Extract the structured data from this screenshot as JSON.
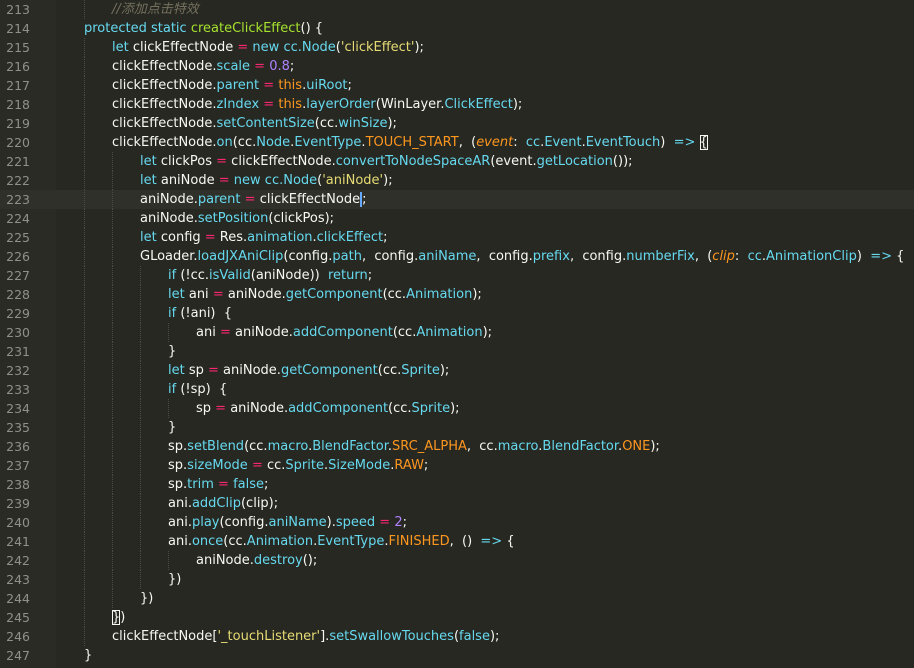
{
  "editor": {
    "lines": [
      {
        "n": "213",
        "indent": 1,
        "tokens": [
          [
            "cm",
            "//添加点击特效"
          ]
        ]
      },
      {
        "n": "214",
        "indent": 0,
        "tokens": [
          [
            "kw",
            "protected"
          ],
          [
            "t",
            " "
          ],
          [
            "kw",
            "static"
          ],
          [
            "t",
            " "
          ],
          [
            "fn",
            "createClickEffect"
          ],
          [
            "t",
            "() {"
          ]
        ]
      },
      {
        "n": "215",
        "indent": 1,
        "tokens": [
          [
            "kw",
            "let"
          ],
          [
            "t",
            " clickEffectNode "
          ],
          [
            "op",
            "="
          ],
          [
            "t",
            " "
          ],
          [
            "kw",
            "new"
          ],
          [
            "t",
            " "
          ],
          [
            "cl",
            "cc.Node"
          ],
          [
            "t",
            "("
          ],
          [
            "st",
            "'clickEffect'"
          ],
          [
            "t",
            ");"
          ]
        ]
      },
      {
        "n": "216",
        "indent": 1,
        "tokens": [
          [
            "t",
            "clickEffectNode."
          ],
          [
            "pr",
            "scale"
          ],
          [
            "t",
            " "
          ],
          [
            "op",
            "="
          ],
          [
            "t",
            " "
          ],
          [
            "nu",
            "0.8"
          ],
          [
            "t",
            ";"
          ]
        ]
      },
      {
        "n": "217",
        "indent": 1,
        "tokens": [
          [
            "t",
            "clickEffectNode."
          ],
          [
            "pr",
            "parent"
          ],
          [
            "t",
            " "
          ],
          [
            "op",
            "="
          ],
          [
            "t",
            " "
          ],
          [
            "th",
            "this"
          ],
          [
            "t",
            "."
          ],
          [
            "pr",
            "uiRoot"
          ],
          [
            "t",
            ";"
          ]
        ]
      },
      {
        "n": "218",
        "indent": 1,
        "tokens": [
          [
            "t",
            "clickEffectNode."
          ],
          [
            "pr",
            "zIndex"
          ],
          [
            "t",
            " "
          ],
          [
            "op",
            "="
          ],
          [
            "t",
            " "
          ],
          [
            "th",
            "this"
          ],
          [
            "t",
            "."
          ],
          [
            "fn2",
            "layerOrder"
          ],
          [
            "t",
            "(WinLayer."
          ],
          [
            "pr",
            "ClickEffect"
          ],
          [
            "t",
            ");"
          ]
        ]
      },
      {
        "n": "219",
        "indent": 1,
        "tokens": [
          [
            "t",
            "clickEffectNode."
          ],
          [
            "fn2",
            "setContentSize"
          ],
          [
            "t",
            "(cc."
          ],
          [
            "pr",
            "winSize"
          ],
          [
            "t",
            ");"
          ]
        ]
      },
      {
        "n": "220",
        "indent": 1,
        "tokens": [
          [
            "t",
            "clickEffectNode."
          ],
          [
            "fn2",
            "on"
          ],
          [
            "t",
            "(cc."
          ],
          [
            "pr",
            "Node"
          ],
          [
            "t",
            "."
          ],
          [
            "pr",
            "EventType"
          ],
          [
            "t",
            "."
          ],
          [
            "ec",
            "TOUCH_START"
          ],
          [
            "t",
            ",  ("
          ],
          [
            "pa",
            "event"
          ],
          [
            "t",
            ":  "
          ],
          [
            "cl",
            "cc"
          ],
          [
            "t",
            "."
          ],
          [
            "cl",
            "Event"
          ],
          [
            "t",
            "."
          ],
          [
            "cl",
            "EventTouch"
          ],
          [
            "t",
            ")  "
          ],
          [
            "kw",
            "=>"
          ],
          [
            "t",
            " "
          ],
          [
            "hl",
            "{"
          ]
        ]
      },
      {
        "n": "221",
        "indent": 2,
        "tokens": [
          [
            "kw",
            "let"
          ],
          [
            "t",
            " clickPos "
          ],
          [
            "op",
            "="
          ],
          [
            "t",
            " clickEffectNode."
          ],
          [
            "fn2",
            "convertToNodeSpaceAR"
          ],
          [
            "t",
            "(event."
          ],
          [
            "fn2",
            "getLocation"
          ],
          [
            "t",
            "());"
          ]
        ]
      },
      {
        "n": "222",
        "indent": 2,
        "tokens": [
          [
            "kw",
            "let"
          ],
          [
            "t",
            " aniNode "
          ],
          [
            "op",
            "="
          ],
          [
            "t",
            " "
          ],
          [
            "kw",
            "new"
          ],
          [
            "t",
            " "
          ],
          [
            "cl",
            "cc.Node"
          ],
          [
            "t",
            "("
          ],
          [
            "st",
            "'aniNode'"
          ],
          [
            "t",
            ");"
          ]
        ]
      },
      {
        "n": "223",
        "indent": 2,
        "active": true,
        "tokens": [
          [
            "t",
            "aniNode."
          ],
          [
            "pr",
            "parent"
          ],
          [
            "t",
            " "
          ],
          [
            "op",
            "="
          ],
          [
            "t",
            " clickEffectNode"
          ],
          [
            "caret",
            ""
          ],
          [
            "t",
            ";"
          ]
        ]
      },
      {
        "n": "224",
        "indent": 2,
        "tokens": [
          [
            "t",
            "aniNode."
          ],
          [
            "fn2",
            "setPosition"
          ],
          [
            "t",
            "(clickPos);"
          ]
        ]
      },
      {
        "n": "225",
        "indent": 2,
        "tokens": [
          [
            "kw",
            "let"
          ],
          [
            "t",
            " config "
          ],
          [
            "op",
            "="
          ],
          [
            "t",
            " Res."
          ],
          [
            "pr",
            "animation"
          ],
          [
            "t",
            "."
          ],
          [
            "pr",
            "clickEffect"
          ],
          [
            "t",
            ";"
          ]
        ]
      },
      {
        "n": "226",
        "indent": 2,
        "tokens": [
          [
            "t",
            "GLoader."
          ],
          [
            "fn2",
            "loadJXAniClip"
          ],
          [
            "t",
            "(config."
          ],
          [
            "pr",
            "path"
          ],
          [
            "t",
            ",  config."
          ],
          [
            "pr",
            "aniName"
          ],
          [
            "t",
            ",  config."
          ],
          [
            "pr",
            "prefix"
          ],
          [
            "t",
            ",  config."
          ],
          [
            "pr",
            "numberFix"
          ],
          [
            "t",
            ",  ("
          ],
          [
            "pa",
            "clip"
          ],
          [
            "t",
            ":  "
          ],
          [
            "cl",
            "cc"
          ],
          [
            "t",
            "."
          ],
          [
            "cl",
            "AnimationClip"
          ],
          [
            "t",
            ")  "
          ],
          [
            "kw",
            "=>"
          ],
          [
            "t",
            " {"
          ]
        ]
      },
      {
        "n": "227",
        "indent": 3,
        "tokens": [
          [
            "kw",
            "if"
          ],
          [
            "t",
            " (!cc."
          ],
          [
            "fn2",
            "isValid"
          ],
          [
            "t",
            "(aniNode))  "
          ],
          [
            "kw",
            "return"
          ],
          [
            "t",
            ";"
          ]
        ]
      },
      {
        "n": "228",
        "indent": 3,
        "tokens": [
          [
            "kw",
            "let"
          ],
          [
            "t",
            " ani "
          ],
          [
            "op",
            "="
          ],
          [
            "t",
            " aniNode."
          ],
          [
            "fn2",
            "getComponent"
          ],
          [
            "t",
            "(cc."
          ],
          [
            "cl",
            "Animation"
          ],
          [
            "t",
            ");"
          ]
        ]
      },
      {
        "n": "229",
        "indent": 3,
        "tokens": [
          [
            "kw",
            "if"
          ],
          [
            "t",
            " (!ani)  {"
          ]
        ]
      },
      {
        "n": "230",
        "indent": 4,
        "tokens": [
          [
            "t",
            "ani "
          ],
          [
            "op",
            "="
          ],
          [
            "t",
            " aniNode."
          ],
          [
            "fn2",
            "addComponent"
          ],
          [
            "t",
            "(cc."
          ],
          [
            "cl",
            "Animation"
          ],
          [
            "t",
            ");"
          ]
        ]
      },
      {
        "n": "231",
        "indent": 3,
        "tokens": [
          [
            "t",
            "}"
          ]
        ]
      },
      {
        "n": "232",
        "indent": 3,
        "tokens": [
          [
            "kw",
            "let"
          ],
          [
            "t",
            " sp "
          ],
          [
            "op",
            "="
          ],
          [
            "t",
            " aniNode."
          ],
          [
            "fn2",
            "getComponent"
          ],
          [
            "t",
            "(cc."
          ],
          [
            "cl",
            "Sprite"
          ],
          [
            "t",
            ");"
          ]
        ]
      },
      {
        "n": "233",
        "indent": 3,
        "tokens": [
          [
            "kw",
            "if"
          ],
          [
            "t",
            " (!sp)  {"
          ]
        ]
      },
      {
        "n": "234",
        "indent": 4,
        "tokens": [
          [
            "t",
            "sp "
          ],
          [
            "op",
            "="
          ],
          [
            "t",
            " aniNode."
          ],
          [
            "fn2",
            "addComponent"
          ],
          [
            "t",
            "(cc."
          ],
          [
            "cl",
            "Sprite"
          ],
          [
            "t",
            ");"
          ]
        ]
      },
      {
        "n": "235",
        "indent": 3,
        "tokens": [
          [
            "t",
            "}"
          ]
        ]
      },
      {
        "n": "236",
        "indent": 3,
        "tokens": [
          [
            "t",
            "sp."
          ],
          [
            "fn2",
            "setBlend"
          ],
          [
            "t",
            "(cc."
          ],
          [
            "pr",
            "macro"
          ],
          [
            "t",
            "."
          ],
          [
            "pr",
            "BlendFactor"
          ],
          [
            "t",
            "."
          ],
          [
            "ec",
            "SRC_ALPHA"
          ],
          [
            "t",
            ",  cc."
          ],
          [
            "pr",
            "macro"
          ],
          [
            "t",
            "."
          ],
          [
            "pr",
            "BlendFactor"
          ],
          [
            "t",
            "."
          ],
          [
            "ec",
            "ONE"
          ],
          [
            "t",
            ");"
          ]
        ]
      },
      {
        "n": "237",
        "indent": 3,
        "tokens": [
          [
            "t",
            "sp."
          ],
          [
            "pr",
            "sizeMode"
          ],
          [
            "t",
            " "
          ],
          [
            "op",
            "="
          ],
          [
            "t",
            " cc."
          ],
          [
            "pr",
            "Sprite"
          ],
          [
            "t",
            "."
          ],
          [
            "pr",
            "SizeMode"
          ],
          [
            "t",
            "."
          ],
          [
            "ec",
            "RAW"
          ],
          [
            "t",
            ";"
          ]
        ]
      },
      {
        "n": "238",
        "indent": 3,
        "tokens": [
          [
            "t",
            "sp."
          ],
          [
            "pr",
            "trim"
          ],
          [
            "t",
            " "
          ],
          [
            "op",
            "="
          ],
          [
            "t",
            " "
          ],
          [
            "kw",
            "false"
          ],
          [
            "t",
            ";"
          ]
        ]
      },
      {
        "n": "239",
        "indent": 3,
        "tokens": [
          [
            "t",
            "ani."
          ],
          [
            "fn2",
            "addClip"
          ],
          [
            "t",
            "(clip);"
          ]
        ]
      },
      {
        "n": "240",
        "indent": 3,
        "tokens": [
          [
            "t",
            "ani."
          ],
          [
            "fn2",
            "play"
          ],
          [
            "t",
            "(config."
          ],
          [
            "pr",
            "aniName"
          ],
          [
            "t",
            ")."
          ],
          [
            "pr",
            "speed"
          ],
          [
            "t",
            " "
          ],
          [
            "op",
            "="
          ],
          [
            "t",
            " "
          ],
          [
            "nu",
            "2"
          ],
          [
            "t",
            ";"
          ]
        ]
      },
      {
        "n": "241",
        "indent": 3,
        "tokens": [
          [
            "t",
            "ani."
          ],
          [
            "fn2",
            "once"
          ],
          [
            "t",
            "(cc."
          ],
          [
            "pr",
            "Animation"
          ],
          [
            "t",
            "."
          ],
          [
            "pr",
            "EventType"
          ],
          [
            "t",
            "."
          ],
          [
            "ec",
            "FINISHED"
          ],
          [
            "t",
            ",  ()  "
          ],
          [
            "kw",
            "=>"
          ],
          [
            "t",
            " {"
          ]
        ]
      },
      {
        "n": "242",
        "indent": 4,
        "tokens": [
          [
            "t",
            "aniNode."
          ],
          [
            "fn2",
            "destroy"
          ],
          [
            "t",
            "();"
          ]
        ]
      },
      {
        "n": "243",
        "indent": 3,
        "tokens": [
          [
            "t",
            "})"
          ]
        ]
      },
      {
        "n": "244",
        "indent": 2,
        "tokens": [
          [
            "t",
            "})"
          ]
        ]
      },
      {
        "n": "245",
        "indent": 1,
        "tokens": [
          [
            "hl",
            "}"
          ],
          [
            "t",
            ")"
          ]
        ]
      },
      {
        "n": "246",
        "indent": 1,
        "tokens": [
          [
            "t",
            "clickEffectNode["
          ],
          [
            "st",
            "'_touchListener'"
          ],
          [
            "t",
            "]."
          ],
          [
            "fn2",
            "setSwallowTouches"
          ],
          [
            "t",
            "("
          ],
          [
            "kw",
            "false"
          ],
          [
            "t",
            ");"
          ]
        ]
      },
      {
        "n": "247",
        "indent": 0,
        "tokens": [
          [
            "t",
            "}"
          ]
        ]
      }
    ]
  }
}
